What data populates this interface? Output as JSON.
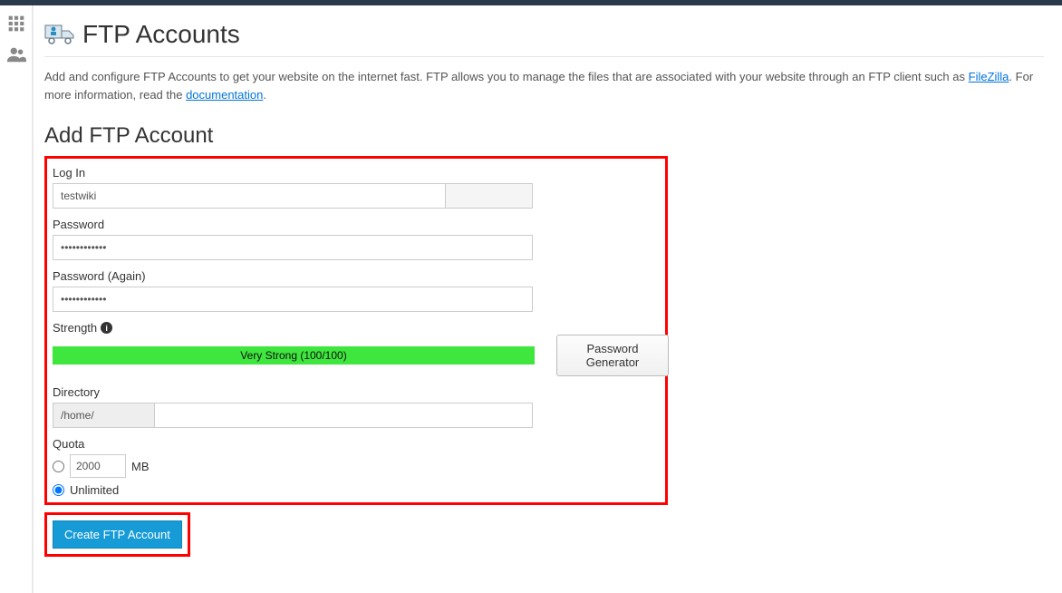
{
  "page": {
    "title": "FTP Accounts"
  },
  "desc": {
    "pre": "Add and configure FTP Accounts to get your website on the internet fast. FTP allows you to manage the files that are associated with your website through an FTP client such as ",
    "link1": "FileZilla",
    "mid": ". For more information, read the ",
    "link2": "documentation",
    "post": "."
  },
  "section": {
    "heading": "Add FTP Account"
  },
  "form": {
    "login": {
      "label": "Log In",
      "value": "testwiki",
      "domain": ""
    },
    "password": {
      "label": "Password",
      "value": "••••••••••••"
    },
    "password_again": {
      "label": "Password (Again)",
      "value": "••••••••••••"
    },
    "strength": {
      "label": "Strength",
      "text": "Very Strong (100/100)"
    },
    "pw_gen": {
      "label": "Password Generator"
    },
    "directory": {
      "label": "Directory",
      "prefix": "/home/",
      "value": ""
    },
    "quota": {
      "label": "Quota",
      "value": "2000",
      "unit": "MB",
      "unlimited": "Unlimited"
    },
    "submit": {
      "label": "Create FTP Account"
    }
  }
}
